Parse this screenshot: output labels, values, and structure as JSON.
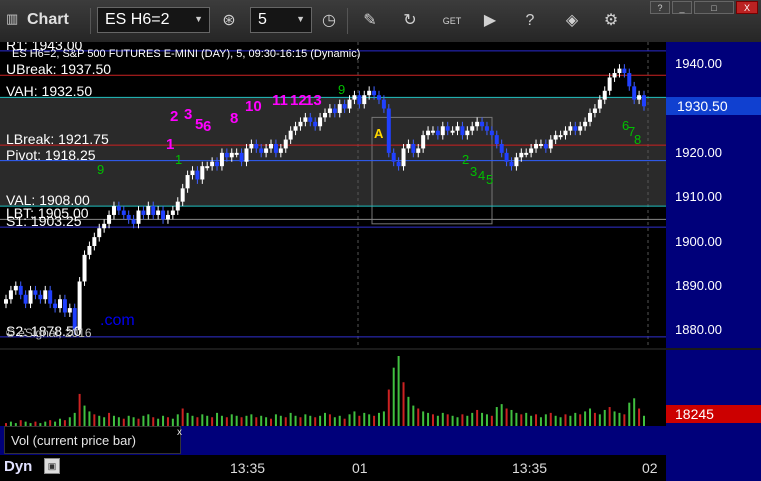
{
  "app": {
    "title": "Chart",
    "icon": "chart-app-icon"
  },
  "toolbar": {
    "symbol": "ES H6=2",
    "interval": "5",
    "icons": [
      "link-icon",
      "clock-icon",
      "pencil-icon",
      "refresh-icon",
      "get-icon",
      "play-icon",
      "tag-icon",
      "settings-icon"
    ]
  },
  "window_controls": {
    "help": "?",
    "minimize": "_",
    "maximize": "□",
    "close": "X"
  },
  "chart": {
    "title": "ES H6=2, S&P 500 FUTURES E-MINI (DAY), 5, 09:30-16:15 (Dynamic)",
    "copyright": "© eSignal, 2016",
    "levels": [
      {
        "name": "R1",
        "label": "R1: 1943.00",
        "value": 1943.0,
        "color": "#2a2ad0"
      },
      {
        "name": "UBreak",
        "label": "UBreak: 1937.50",
        "value": 1937.5,
        "color": "#cc2222"
      },
      {
        "name": "VAH",
        "label": "VAH: 1932.50",
        "value": 1932.5,
        "color": "#20c0c0"
      },
      {
        "name": "LBreak",
        "label": "LBreak: 1921.75",
        "value": 1921.75,
        "color": "#cc2222"
      },
      {
        "name": "Pivot",
        "label": "Pivot: 1918.25",
        "value": 1918.25,
        "color": "#3060ff"
      },
      {
        "name": "VAL",
        "label": "VAL: 1908.00",
        "value": 1908.0,
        "color": "#20c0c0"
      },
      {
        "name": "LBT",
        "label": "LBT: 1905.00",
        "value": 1905.0,
        "color": "#888888"
      },
      {
        "name": "S1",
        "label": "S1: 1903.25",
        "value": 1903.25,
        "color": "#3030d0"
      },
      {
        "name": "S2",
        "label": "S2: 1878.50",
        "value": 1878.5,
        "color": "#3030d0"
      }
    ],
    "price_ticks": [
      "1940.00",
      "1930.00",
      "1920.00",
      "1910.00",
      "1900.00",
      "1890.00",
      "1880.00"
    ],
    "last_price": "1930.50",
    "time_ticks": [
      "13:35",
      "01",
      "13:35",
      "02"
    ],
    "marker_a": "A",
    "com_label": ".com",
    "counts_magenta": [
      "2",
      "3",
      "5",
      "6",
      "8",
      "10",
      "11",
      "12",
      "13",
      "1"
    ],
    "counts_green": [
      "9",
      "1",
      "2",
      "3",
      "4",
      "5",
      "6",
      "7",
      "8",
      "9"
    ]
  },
  "volume": {
    "legend": "Vol (current price bar)",
    "close": "x",
    "last_value": "18245"
  },
  "status": {
    "dyn": "Dyn"
  },
  "chart_data": {
    "type": "candlestick",
    "title": "ES H6=2, S&P 500 FUTURES E-MINI (DAY), 5, 09:30-16:15 (Dynamic)",
    "ylim": [
      1876,
      1945
    ],
    "y_ticks": [
      1880,
      1890,
      1900,
      1910,
      1920,
      1930,
      1940
    ],
    "x_ticks": [
      "13:35",
      "01",
      "13:35",
      "02"
    ],
    "last": 1930.5,
    "last_volume": 18245,
    "grid": false,
    "closes": [
      1887,
      1889,
      1890,
      1888,
      1886,
      1889,
      1888,
      1887,
      1889,
      1886,
      1885,
      1887,
      1884,
      1885,
      1880,
      1891,
      1897,
      1899,
      1901,
      1903,
      1904,
      1906,
      1908,
      1907,
      1906,
      1905,
      1904,
      1907,
      1906,
      1908,
      1906,
      1907,
      1905,
      1906,
      1907,
      1909,
      1912,
      1915,
      1916,
      1914,
      1917,
      1917,
      1918,
      1917,
      1920,
      1919,
      1920,
      1920,
      1918,
      1921,
      1922,
      1921,
      1920,
      1921,
      1922,
      1920,
      1921,
      1923,
      1925,
      1926,
      1927,
      1928,
      1927,
      1926,
      1928,
      1929,
      1930,
      1929,
      1931,
      1930,
      1932,
      1933,
      1931,
      1933,
      1934,
      1933,
      1932,
      1930,
      1920,
      1918,
      1917,
      1921,
      1922,
      1920,
      1921,
      1924,
      1925,
      1925,
      1924,
      1926,
      1925,
      1925,
      1926,
      1924,
      1925,
      1926,
      1927,
      1926,
      1925,
      1924,
      1922,
      1920,
      1918,
      1917,
      1919,
      1920,
      1920,
      1921,
      1922,
      1922,
      1921,
      1923,
      1924,
      1924,
      1925,
      1926,
      1925,
      1926,
      1927,
      1929,
      1930,
      1932,
      1934,
      1937,
      1938,
      1939,
      1938,
      1935,
      1932,
      1933,
      1930.5
    ],
    "volumes": [
      2,
      3,
      2,
      4,
      3,
      2,
      3,
      2,
      3,
      4,
      3,
      5,
      4,
      6,
      9,
      22,
      14,
      10,
      8,
      7,
      6,
      9,
      7,
      6,
      5,
      7,
      6,
      5,
      7,
      8,
      6,
      5,
      7,
      6,
      5,
      8,
      12,
      9,
      7,
      6,
      8,
      7,
      6,
      9,
      7,
      6,
      8,
      7,
      6,
      7,
      8,
      6,
      7,
      6,
      5,
      8,
      7,
      6,
      9,
      7,
      6,
      8,
      7,
      6,
      7,
      9,
      8,
      6,
      7,
      5,
      8,
      10,
      7,
      9,
      8,
      7,
      9,
      10,
      25,
      40,
      48,
      30,
      20,
      14,
      12,
      10,
      9,
      8,
      7,
      9,
      8,
      7,
      6,
      8,
      7,
      9,
      11,
      9,
      8,
      7,
      13,
      15,
      12,
      11,
      9,
      8,
      9,
      7,
      8,
      6,
      8,
      9,
      7,
      6,
      8,
      7,
      9,
      8,
      10,
      12,
      9,
      8,
      11,
      13,
      10,
      9,
      8,
      16,
      19,
      12,
      7
    ]
  }
}
